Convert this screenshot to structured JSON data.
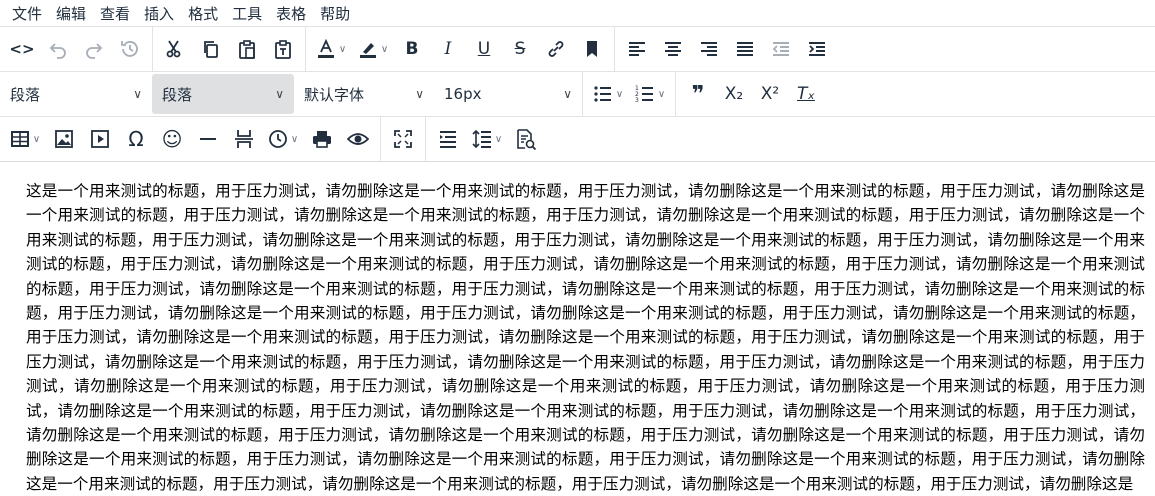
{
  "menu": [
    "文件",
    "编辑",
    "查看",
    "插入",
    "格式",
    "工具",
    "表格",
    "帮助"
  ],
  "toolbar1": {
    "code": "<>",
    "bold": "B",
    "italic": "I",
    "underline": "U",
    "strike": "S"
  },
  "toolbar2": {
    "block_format_1": "段落",
    "block_format_2": "段落",
    "font_family": "默认字体",
    "font_size": "16px",
    "blockquote": "❞",
    "subscript": "X₂",
    "superscript": "X²",
    "clear_format": "Tₓ"
  },
  "toolbar3": {
    "special_char": "Ω",
    "emoticon": "☺"
  },
  "content": {
    "text": "这是一个用来测试的标题，用于压力测试，请勿删除这是一个用来测试的标题，用于压力测试，请勿删除这是一个用来测试的标题，用于压力测试，请勿删除这是一个用来测试的标题，用于压力测试，请勿删除这是一个用来测试的标题，用于压力测试，请勿删除这是一个用来测试的标题，用于压力测试，请勿删除这是一个用来测试的标题，用于压力测试，请勿删除这是一个用来测试的标题，用于压力测试，请勿删除这是一个用来测试的标题，用于压力测试，请勿删除这是一个用来测试的标题，用于压力测试，请勿删除这是一个用来测试的标题，用于压力测试，请勿删除这是一个用来测试的标题，用于压力测试，请勿删除这是一个用来测试的标题，用于压力测试，请勿删除这是一个用来测试的标题，用于压力测试，请勿删除这是一个用来测试的标题，用于压力测试，请勿删除这是一个用来测试的标题，用于压力测试，请勿删除这是一个用来测试的标题，用于压力测试，请勿删除这是一个用来测试的标题，用于压力测试，请勿删除这是一个用来测试的标题，用于压力测试，请勿删除这是一个用来测试的标题，用于压力测试，请勿删除这是一个用来测试的标题，用于压力测试，请勿删除这是一个用来测试的标题，用于压力测试，请勿删除这是一个用来测试的标题，用于压力测试，请勿删除这是一个用来测试的标题，用于压力测试，请勿删除这是一个用来测试的标题，用于压力测试，请勿删除这是一个用来测试的标题，用于压力测试，请勿删除这是一个用来测试的标题，用于压力测试，请勿删除这是一个用来测试的标题，用于压力测试，请勿删除这是一个用来测试的标题，用于压力测试，请勿删除这是一个用来测试的标题，用于压力测试，请勿删除这是一个用来测试的标题，用于压力测试，请勿删除这是一个用来测试的标题，用于压力测试，请勿删除这是一个用来测试的标题，用于压力测试，请勿删除这是一个用来测试的标题，用于压力测试，请勿删除这是一个用来测试的标题，用于压力测试，请勿删除这是一个用来测试的标题，用于压力测试，请勿删除这是一个用来测试的标题，用于压力测试，请勿删除这是一个用来测试的标题，用于压力测试，请勿删除这是一个用来测试的标题，用于压力测试，请勿删除这是一个用来测试的标题，用于压力测试，请勿删除这是"
  }
}
